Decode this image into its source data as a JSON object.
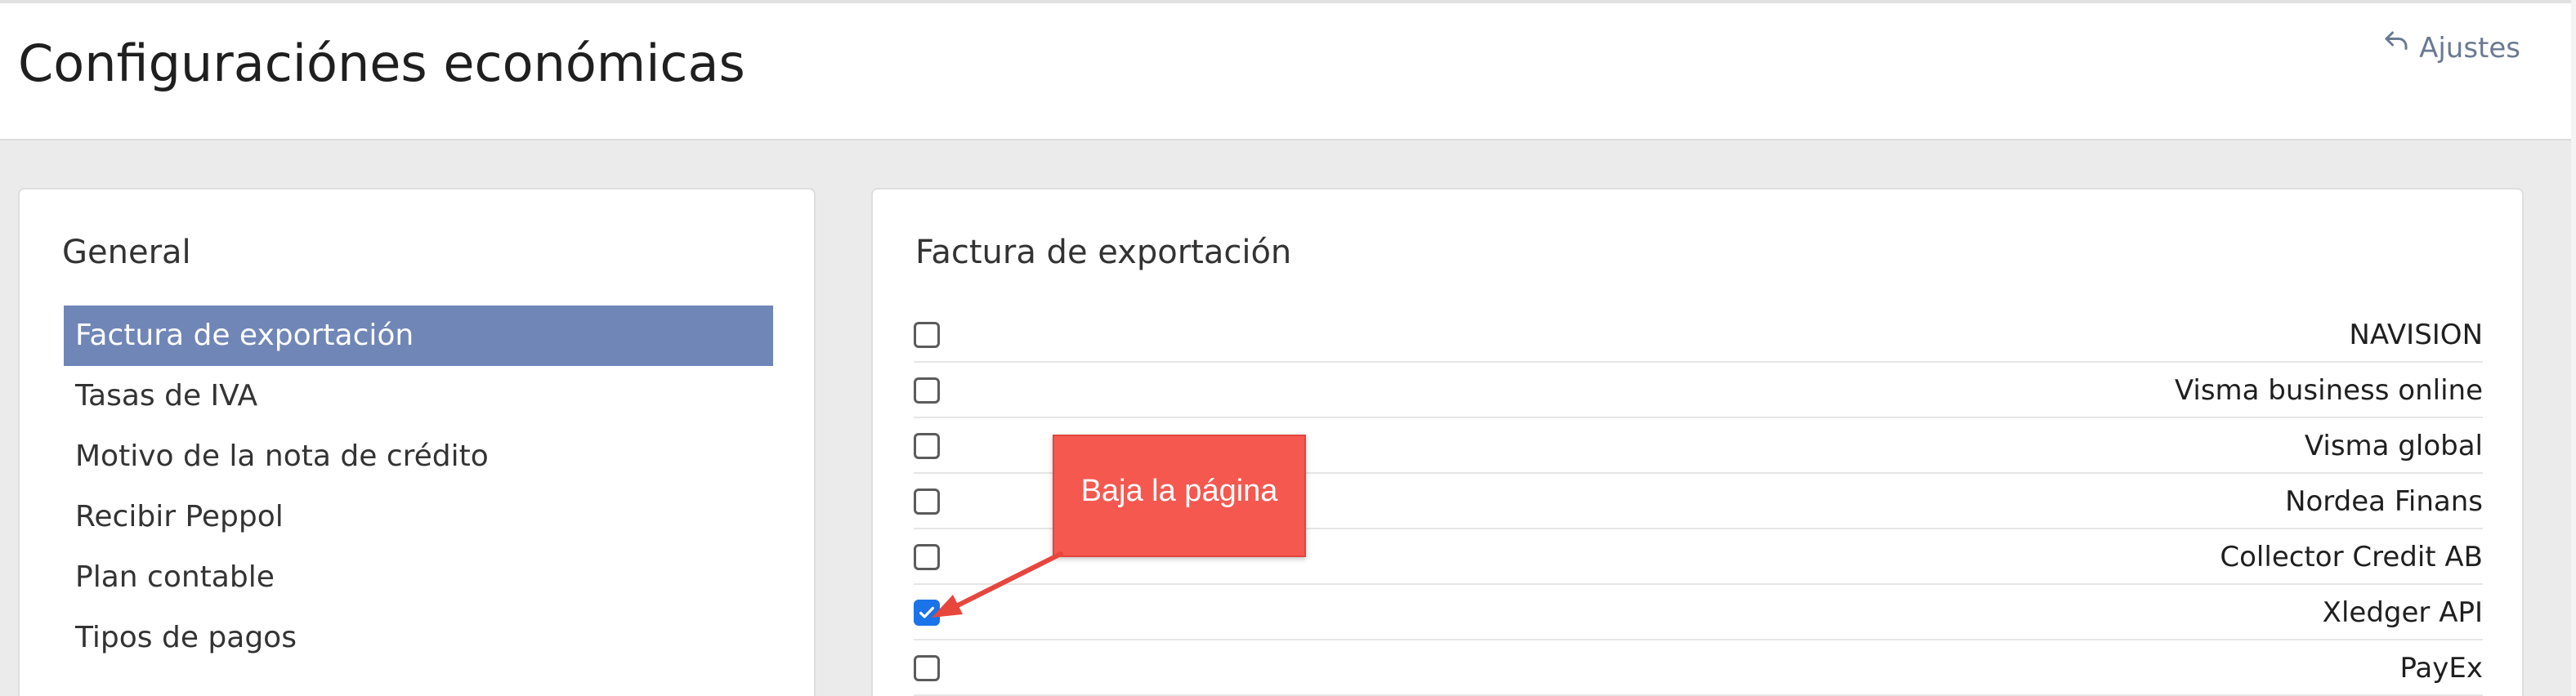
{
  "header": {
    "title": "Configuraciónes económicas",
    "settings_link": "Ajustes",
    "settings_icon": "reply-arrow-icon"
  },
  "sidebar": {
    "title": "General",
    "items": [
      {
        "label": "Factura de exportación",
        "active": true
      },
      {
        "label": "Tasas de IVA",
        "active": false
      },
      {
        "label": "Motivo de la nota de crédito",
        "active": false
      },
      {
        "label": "Recibir Peppol",
        "active": false
      },
      {
        "label": "Plan contable",
        "active": false
      },
      {
        "label": "Tipos de pagos",
        "active": false
      }
    ]
  },
  "export": {
    "title": "Factura de exportación",
    "options": [
      {
        "label": "NAVISION",
        "checked": false
      },
      {
        "label": "Visma business online",
        "checked": false
      },
      {
        "label": "Visma global",
        "checked": false
      },
      {
        "label": "Nordea Finans",
        "checked": false
      },
      {
        "label": "Collector Credit AB",
        "checked": false
      },
      {
        "label": "Xledger API",
        "checked": true
      },
      {
        "label": "PayEx",
        "checked": false
      }
    ]
  },
  "annotation": {
    "text": "Baja la página",
    "color": "#f5584f"
  },
  "colors": {
    "active_nav": "#6f86b7",
    "checkbox_checked": "#1a73e8",
    "link": "#6a7a92"
  }
}
